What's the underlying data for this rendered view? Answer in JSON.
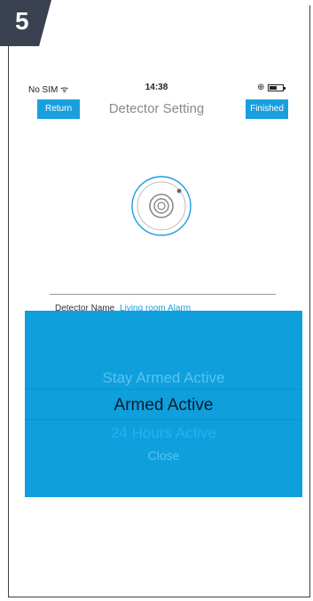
{
  "step": {
    "number": "5"
  },
  "status_bar": {
    "carrier": "No SIM",
    "time": "14:38"
  },
  "header": {
    "return_label": "Return",
    "title": "Detector Setting",
    "finished_label": "Finished"
  },
  "detector": {
    "label": "Detector Name",
    "value": "Living room Alarm"
  },
  "picker": {
    "options": [
      "Stay Armed Active",
      "Armed Active",
      "24 Hours Active",
      "Close"
    ],
    "selected": "Armed Active"
  },
  "colors": {
    "accent": "#1a9fde",
    "sheet": "#0f9fdd",
    "step_badge": "#3a4150"
  }
}
